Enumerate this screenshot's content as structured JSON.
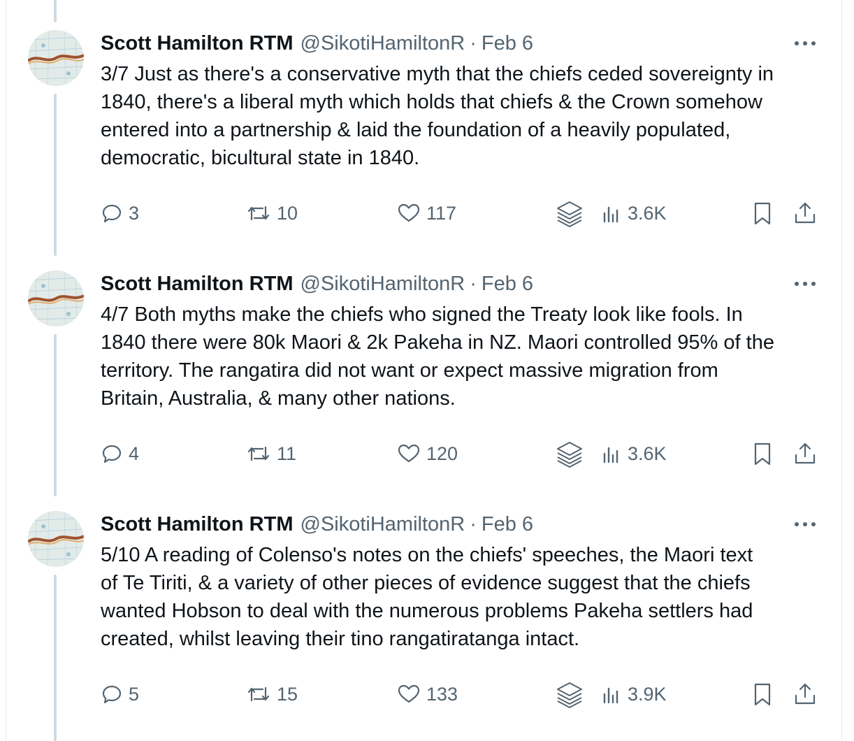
{
  "colors": {
    "text_primary": "#0f1419",
    "text_secondary": "#536471",
    "thread_line": "#cfd9de",
    "background": "#ffffff"
  },
  "icons": {
    "reply": "reply-icon",
    "retweet": "retweet-icon",
    "like": "heart-icon",
    "grok": "layers-icon",
    "views": "views-icon",
    "bookmark": "bookmark-icon",
    "share": "share-icon",
    "more": "more-dots-icon"
  },
  "tweets": [
    {
      "author_name": "Scott Hamilton RTM",
      "handle": "@SikotiHamiltonR",
      "separator": "·",
      "date": "Feb 6",
      "text": "3/7 Just as there's a conservative myth that the chiefs ceded sovereignty in\n1840, there's a liberal myth which holds that chiefs & the Crown somehow\nentered into a partnership & laid the foundation of a heavily populated,\ndemocratic, bicultural state in 1840.",
      "replies": "3",
      "reposts": "10",
      "likes": "117",
      "views": "3.6K"
    },
    {
      "author_name": "Scott Hamilton RTM",
      "handle": "@SikotiHamiltonR",
      "separator": "·",
      "date": "Feb 6",
      "text": "4/7 Both myths make the chiefs who signed the Treaty look like fools. In\n1840 there were 80k Maori & 2k Pakeha in NZ. Maori controlled 95% of the\nterritory. The rangatira did not want or expect massive migration from\nBritain, Australia, & many other nations.",
      "replies": "4",
      "reposts": "11",
      "likes": "120",
      "views": "3.6K"
    },
    {
      "author_name": "Scott Hamilton RTM",
      "handle": "@SikotiHamiltonR",
      "separator": "·",
      "date": "Feb 6",
      "text": "5/10 A reading of Colenso's notes on the chiefs' speeches, the Maori text\nof Te Tiriti, & a variety of other pieces of evidence suggest that the chiefs\nwanted Hobson to deal with the numerous problems Pakeha settlers had\ncreated, whilst leaving their tino rangatiratanga intact.",
      "replies": "5",
      "reposts": "15",
      "likes": "133",
      "views": "3.9K"
    }
  ]
}
